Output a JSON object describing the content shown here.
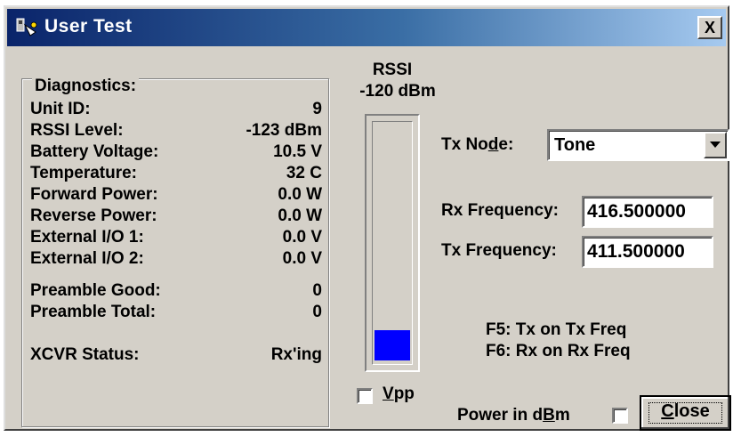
{
  "window": {
    "title": "User Test",
    "close_symbol": "X"
  },
  "diagnostics": {
    "legend": "Diagnostics:",
    "rows": [
      {
        "label": "Unit ID:",
        "value": "9"
      },
      {
        "label": "RSSI Level:",
        "value": "-123 dBm"
      },
      {
        "label": "Battery Voltage:",
        "value": "10.5 V"
      },
      {
        "label": "Temperature:",
        "value": "32 C"
      },
      {
        "label": "Forward Power:",
        "value": "0.0 W"
      },
      {
        "label": "Reverse Power:",
        "value": "0.0 W"
      },
      {
        "label": "External I/O 1:",
        "value": "0.0 V"
      },
      {
        "label": "External I/O 2:",
        "value": "0.0 V"
      },
      {
        "label": "Preamble Good:",
        "value": "0"
      },
      {
        "label": "Preamble Total:",
        "value": "0"
      },
      {
        "label": "XCVR Status:",
        "value": "Rx'ing"
      }
    ]
  },
  "rssi": {
    "title": "RSSI",
    "value_text": "-120 dBm",
    "level_fraction": 0.13,
    "fill_color": "#0000ff"
  },
  "vpp": {
    "label_prefix": "",
    "label_accel": "V",
    "label_rest": "pp",
    "checked": false
  },
  "tx_mode": {
    "label_pre": "Tx No",
    "label_accel": "d",
    "label_post": "e:",
    "value": "Tone"
  },
  "rx_frequency": {
    "label": "Rx Frequency:",
    "value": "416.500000"
  },
  "tx_frequency": {
    "label": "Tx Frequency:",
    "value": "411.500000"
  },
  "hotkeys": {
    "f5": "F5: Tx on Tx Freq",
    "f6": "F6: Rx on Rx Freq"
  },
  "power_dbm": {
    "label_pre": "Power in d",
    "label_accel": "B",
    "label_post": "m",
    "checked": false
  },
  "close_button": {
    "label_accel": "C",
    "label_rest": "lose"
  }
}
